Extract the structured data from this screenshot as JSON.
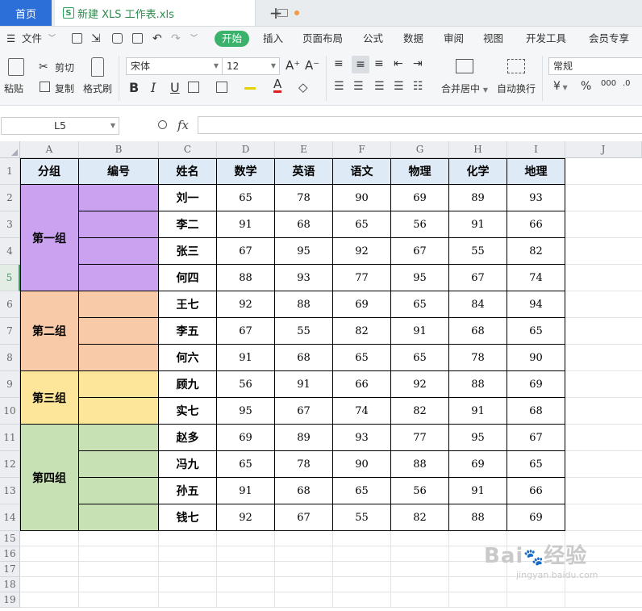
{
  "tabs": {
    "home": "首页",
    "document": "新建 XLS 工作表.xls",
    "add": "+"
  },
  "menu": {
    "file": "文件",
    "items": [
      "开始",
      "插入",
      "页面布局",
      "公式",
      "数据",
      "审阅",
      "视图",
      "开发工具",
      "会员专享"
    ]
  },
  "ribbon": {
    "paste": "粘贴",
    "cut": "剪切",
    "copy": "复制",
    "format_painter": "格式刷",
    "font_name": "宋体",
    "font_size": "12",
    "merge_center": "合并居中",
    "wrap_text": "自动换行",
    "number_format": "常规",
    "bold": "B",
    "italic": "I",
    "underline": "U",
    "percent": "%",
    "currency": "¥",
    "font_bigger": "A⁺",
    "font_smaller": "A⁻"
  },
  "formula_bar": {
    "name_box": "L5",
    "fx": "fx",
    "value": ""
  },
  "columns": [
    "A",
    "B",
    "C",
    "D",
    "E",
    "F",
    "G",
    "H",
    "I",
    "J"
  ],
  "rows": [
    "1",
    "2",
    "3",
    "4",
    "5",
    "6",
    "7",
    "8",
    "9",
    "10",
    "11",
    "12",
    "13",
    "14",
    "15",
    "16",
    "17",
    "18",
    "19"
  ],
  "selected_row": "5",
  "table": {
    "headers": [
      "分组",
      "编号",
      "姓名",
      "数学",
      "英语",
      "语文",
      "物理",
      "化学",
      "地理"
    ],
    "groups": [
      {
        "name": "第一组",
        "color": "#cba2f0",
        "rows": 4
      },
      {
        "name": "第二组",
        "color": "#f8caa8",
        "rows": 3
      },
      {
        "name": "第三组",
        "color": "#fde69a",
        "rows": 2
      },
      {
        "name": "第四组",
        "color": "#c7e1b5",
        "rows": 4
      }
    ],
    "records": [
      [
        "刘一",
        "65",
        "78",
        "90",
        "69",
        "89",
        "93"
      ],
      [
        "李二",
        "91",
        "68",
        "65",
        "56",
        "91",
        "66"
      ],
      [
        "张三",
        "67",
        "95",
        "92",
        "67",
        "55",
        "82"
      ],
      [
        "何四",
        "88",
        "93",
        "77",
        "95",
        "67",
        "74"
      ],
      [
        "王七",
        "92",
        "88",
        "69",
        "65",
        "84",
        "94"
      ],
      [
        "李五",
        "67",
        "55",
        "82",
        "91",
        "68",
        "65"
      ],
      [
        "何六",
        "91",
        "68",
        "65",
        "65",
        "78",
        "90"
      ],
      [
        "顾九",
        "56",
        "91",
        "66",
        "92",
        "88",
        "69"
      ],
      [
        "实七",
        "95",
        "67",
        "74",
        "82",
        "91",
        "68"
      ],
      [
        "赵多",
        "69",
        "89",
        "93",
        "77",
        "95",
        "67"
      ],
      [
        "冯九",
        "65",
        "78",
        "90",
        "88",
        "69",
        "65"
      ],
      [
        "孙五",
        "91",
        "68",
        "65",
        "56",
        "91",
        "66"
      ],
      [
        "钱七",
        "92",
        "67",
        "55",
        "82",
        "88",
        "69"
      ]
    ],
    "header_color": "#deeaf6"
  },
  "watermark": {
    "brand": "Bai",
    "cn": "经验",
    "url": "jingyan.baidu.com"
  },
  "colors": {
    "accent": "#3ab26b",
    "home_tab": "#2c6fd8"
  }
}
